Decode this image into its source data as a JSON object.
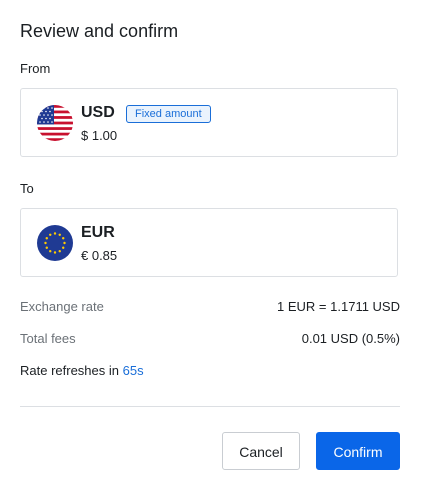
{
  "dialog": {
    "title": "Review and confirm"
  },
  "from": {
    "section_label": "From",
    "currency_code": "USD",
    "amount": "$ 1.00",
    "badge": "Fixed amount",
    "flag_icon": "us-flag-icon"
  },
  "to": {
    "section_label": "To",
    "currency_code": "EUR",
    "amount": "€ 0.85",
    "flag_icon": "eu-flag-icon"
  },
  "details": {
    "exchange_rate_label": "Exchange rate",
    "exchange_rate_value": "1 EUR = 1.1711 USD",
    "total_fees_label": "Total fees",
    "total_fees_value": "0.01 USD (0.5%)",
    "refresh_prefix": "Rate refreshes in",
    "refresh_countdown": "65s"
  },
  "actions": {
    "cancel_label": "Cancel",
    "confirm_label": "Confirm"
  },
  "colors": {
    "accent": "#0a66e8",
    "link": "#1a6ed8",
    "border": "#dcdfe3",
    "muted_text": "#6b7177"
  }
}
